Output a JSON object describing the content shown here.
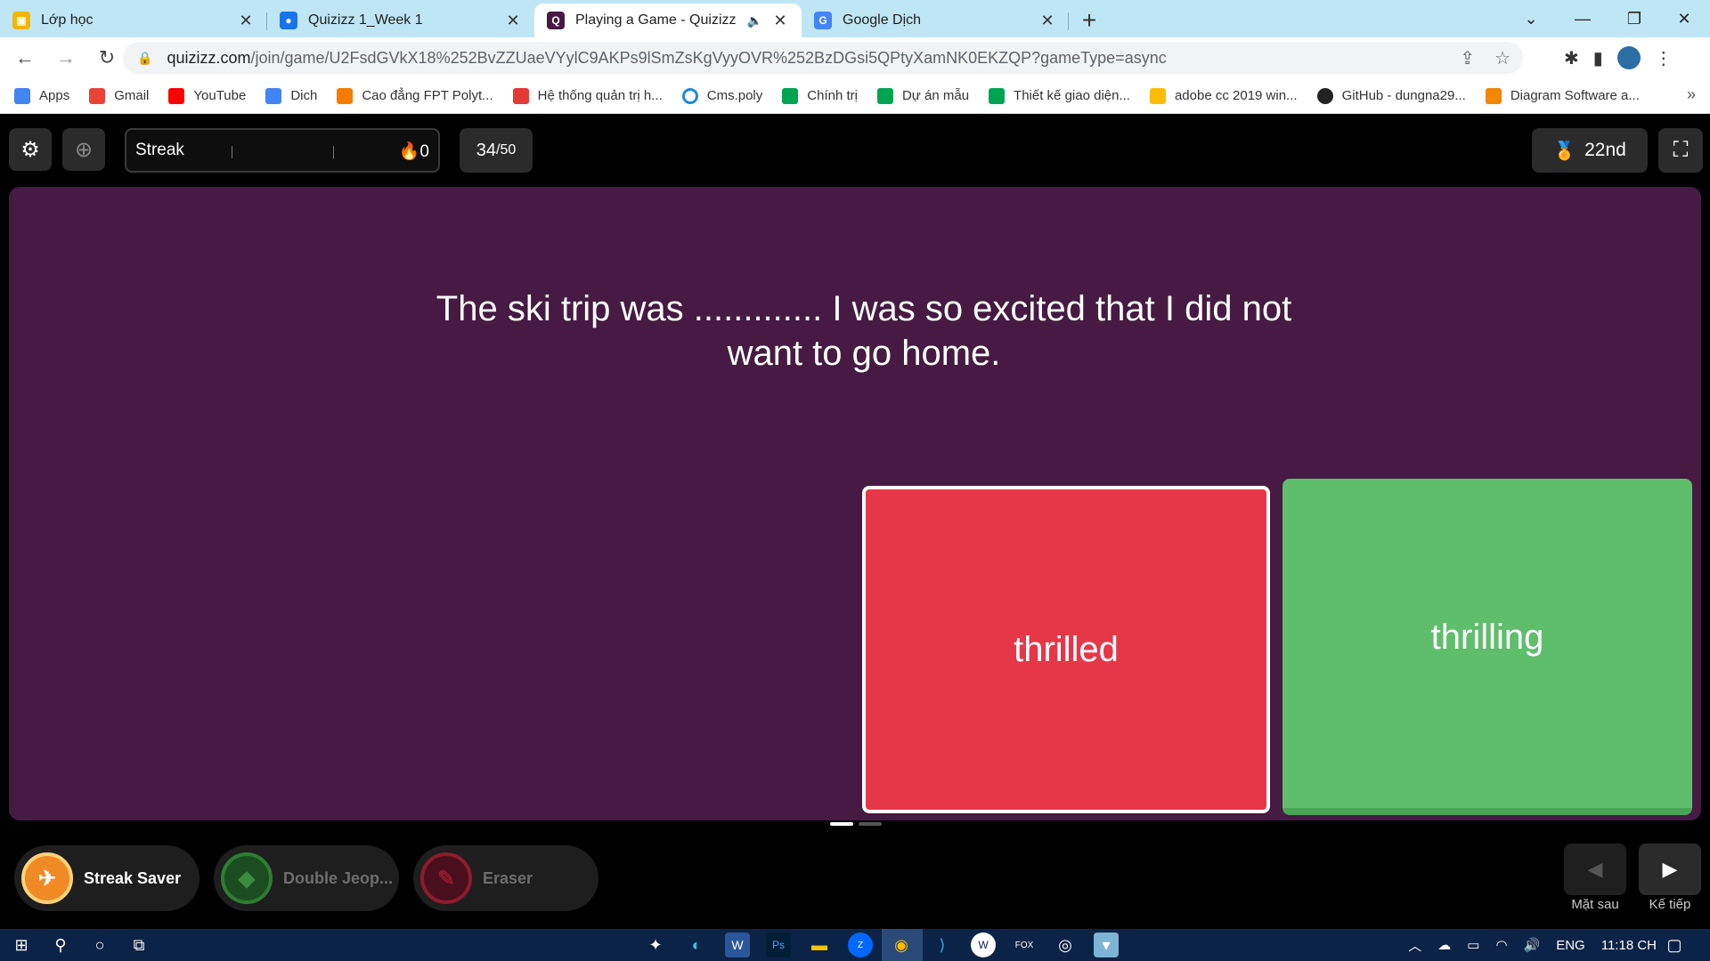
{
  "browser": {
    "tabs": [
      {
        "title": "Lớp học",
        "icon": "classroom-icon",
        "color": "#f4b400"
      },
      {
        "title": "Quizizz 1_Week 1",
        "icon": "classroom-user-icon",
        "color": "#1a73e8"
      },
      {
        "title": "Playing a Game - Quizizz",
        "icon": "quizizz-icon",
        "color": "#461a42"
      },
      {
        "title": "Google Dịch",
        "icon": "translate-icon",
        "color": "#4285f4"
      }
    ],
    "url_host": "quizizz.com",
    "url_rest": "/join/game/U2FsdGVkX18%252BvZZUaeVYylC9AKPs9lSmZsKgVyyOVR%252BzDGsi5QPtyXamNK0EKZQP?gameType=async",
    "bookmarks": [
      {
        "label": "Apps",
        "color": "#4285f4"
      },
      {
        "label": "Gmail",
        "color": "#ea4335"
      },
      {
        "label": "YouTube",
        "color": "#ff0000"
      },
      {
        "label": "Dich",
        "color": "#4285f4"
      },
      {
        "label": "Cao đẳng FPT Polyt...",
        "color": "#f57c00"
      },
      {
        "label": "Hệ thống quản trị h...",
        "color": "#e53935"
      },
      {
        "label": "Cms.poly",
        "color": "#1e88e5"
      },
      {
        "label": "Chính trị",
        "color": "#00a64f"
      },
      {
        "label": "Dự án mẫu",
        "color": "#00a64f"
      },
      {
        "label": "Thiết kế giao diện...",
        "color": "#00a64f"
      },
      {
        "label": "adobe cc 2019 win...",
        "color": "#fbbc04"
      },
      {
        "label": "GitHub - dungna29...",
        "color": "#222222"
      },
      {
        "label": "Diagram Software a...",
        "color": "#f08705"
      }
    ]
  },
  "game": {
    "streak_label": "Streak",
    "streak_count": "0",
    "question_current": "34",
    "question_total": "/50",
    "rank": "22nd",
    "question": "The ski trip was ............. I was so excited that I did not want to go home.",
    "answers": [
      {
        "text": "thrilled",
        "color": "#e63749"
      },
      {
        "text": "thrilling",
        "color": "#5fbe6c"
      }
    ],
    "powerups": [
      {
        "label": "Streak Saver",
        "state": "active",
        "color": "#f08a24"
      },
      {
        "label": "Double Jeop...",
        "state": "dim",
        "color": "#2e7d32"
      },
      {
        "label": "Eraser",
        "state": "dim",
        "color": "#8e1b2e"
      }
    ],
    "nav_prev_label": "Mặt sau",
    "nav_next_label": "Kế tiếp"
  },
  "taskbar": {
    "language": "ENG",
    "time": "11:18 CH"
  }
}
